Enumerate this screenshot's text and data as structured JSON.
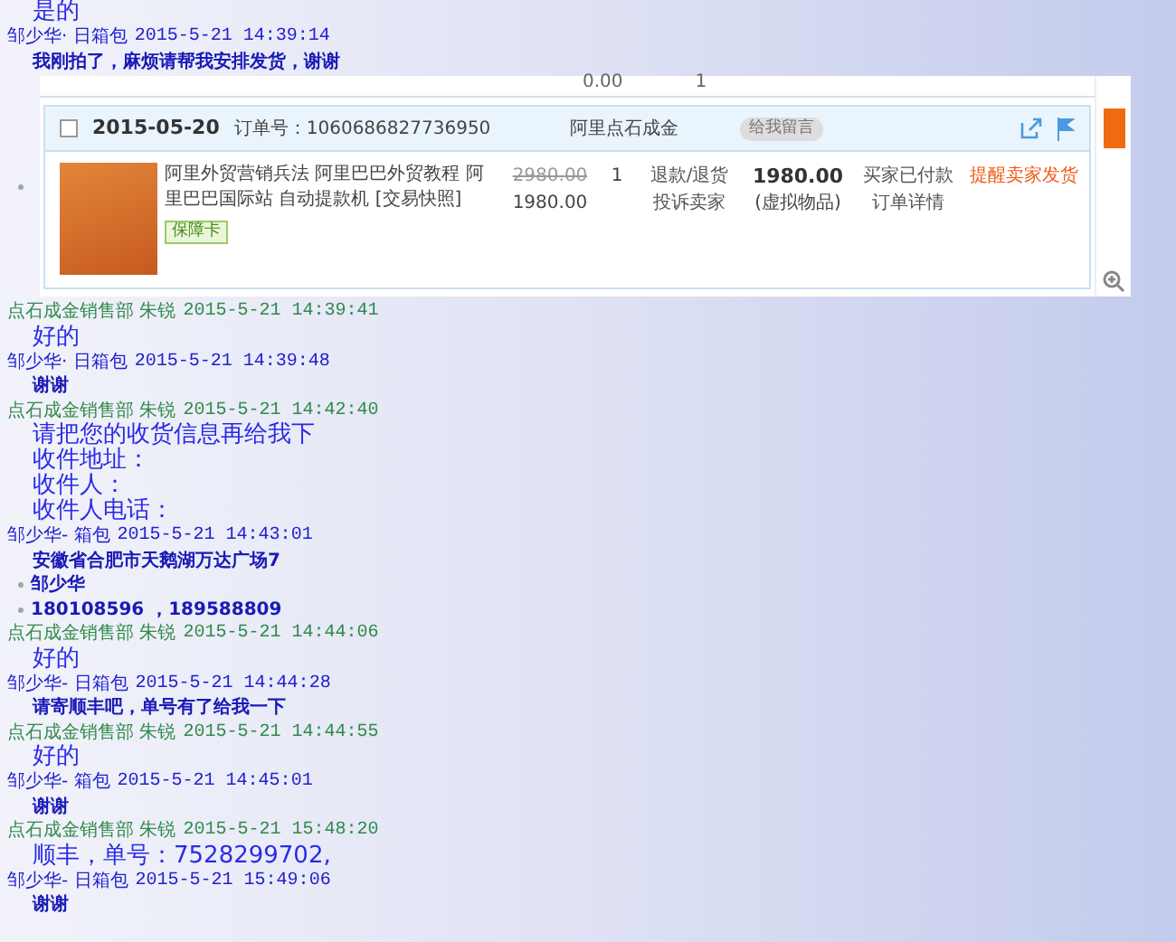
{
  "log": [
    {
      "kind": "large_text",
      "lines": [
        "是的"
      ]
    },
    {
      "kind": "buyer_header",
      "sender": "邹少华· 日箱包",
      "time": "2015-5-21 14:39:14"
    },
    {
      "kind": "small_text",
      "lines": [
        "我刚拍了，麻烦请帮我安排发货，谢谢"
      ]
    },
    {
      "kind": "order",
      "bullet": true,
      "prev_row": {
        "amount": "0.00",
        "qty": "1"
      },
      "date": "2015-05-20",
      "order_no": "订单号：1060686827736950",
      "shop": "阿里点石成金",
      "message_button": "给我留言",
      "checked": false,
      "item": {
        "title": "阿里外贸营销兵法 阿里巴巴外贸教程 阿里巴巴国际站 自动提款机 [交易快照]",
        "badge": "保障卡",
        "original_price": "2980.00",
        "price": "1980.00",
        "qty": "1",
        "actions": [
          "退款/退货",
          "投诉卖家"
        ],
        "total": "1980.00",
        "total_note": "(虚拟物品)",
        "status": [
          "买家已付款",
          "订单详情"
        ],
        "remind": "提醒卖家发货"
      }
    },
    {
      "kind": "seller_header",
      "sender": "点石成金销售部 朱锐",
      "time": "2015-5-21 14:39:41"
    },
    {
      "kind": "large_text",
      "lines": [
        "好的"
      ]
    },
    {
      "kind": "buyer_header",
      "sender": "邹少华· 日箱包",
      "time": "2015-5-21 14:39:48"
    },
    {
      "kind": "small_text",
      "lines": [
        "谢谢"
      ]
    },
    {
      "kind": "seller_header",
      "sender": "点石成金销售部 朱锐",
      "time": "2015-5-21 14:42:40"
    },
    {
      "kind": "large_text",
      "lines": [
        "请把您的收货信息再给我下",
        "收件地址：",
        "收件人：",
        "收件人电话："
      ]
    },
    {
      "kind": "buyer_header",
      "sender": "邹少华- 箱包",
      "time": "2015-5-21 14:43:01"
    },
    {
      "kind": "small_text",
      "lines": [
        "安徽省合肥市天鹅湖万达广场7"
      ]
    },
    {
      "kind": "small_text",
      "bullet": true,
      "lines": [
        "邹少华"
      ]
    },
    {
      "kind": "small_text",
      "bullet": true,
      "lines": [
        "180108596 ，189588809"
      ]
    },
    {
      "kind": "seller_header",
      "sender": "点石成金销售部 朱锐",
      "time": "2015-5-21 14:44:06"
    },
    {
      "kind": "large_text",
      "lines": [
        "好的"
      ]
    },
    {
      "kind": "buyer_header",
      "sender": "邹少华- 日箱包",
      "time": "2015-5-21 14:44:28"
    },
    {
      "kind": "small_text",
      "lines": [
        "请寄顺丰吧，单号有了给我一下"
      ]
    },
    {
      "kind": "seller_header",
      "sender": "点石成金销售部 朱锐",
      "time": "2015-5-21 14:44:55"
    },
    {
      "kind": "large_text",
      "lines": [
        "好的"
      ]
    },
    {
      "kind": "buyer_header",
      "sender": "邹少华- 箱包",
      "time": "2015-5-21 14:45:01"
    },
    {
      "kind": "small_text",
      "lines": [
        "谢谢"
      ]
    },
    {
      "kind": "seller_header",
      "sender": "点石成金销售部 朱锐",
      "time": "2015-5-21 15:48:20"
    },
    {
      "kind": "large_text",
      "lines": [
        "顺丰，单号：7528299702,"
      ]
    },
    {
      "kind": "buyer_header",
      "sender": "邹少华- 日箱包",
      "time": "2015-5-21 15:49:06"
    },
    {
      "kind": "small_text",
      "lines": [
        "谢谢"
      ]
    }
  ]
}
